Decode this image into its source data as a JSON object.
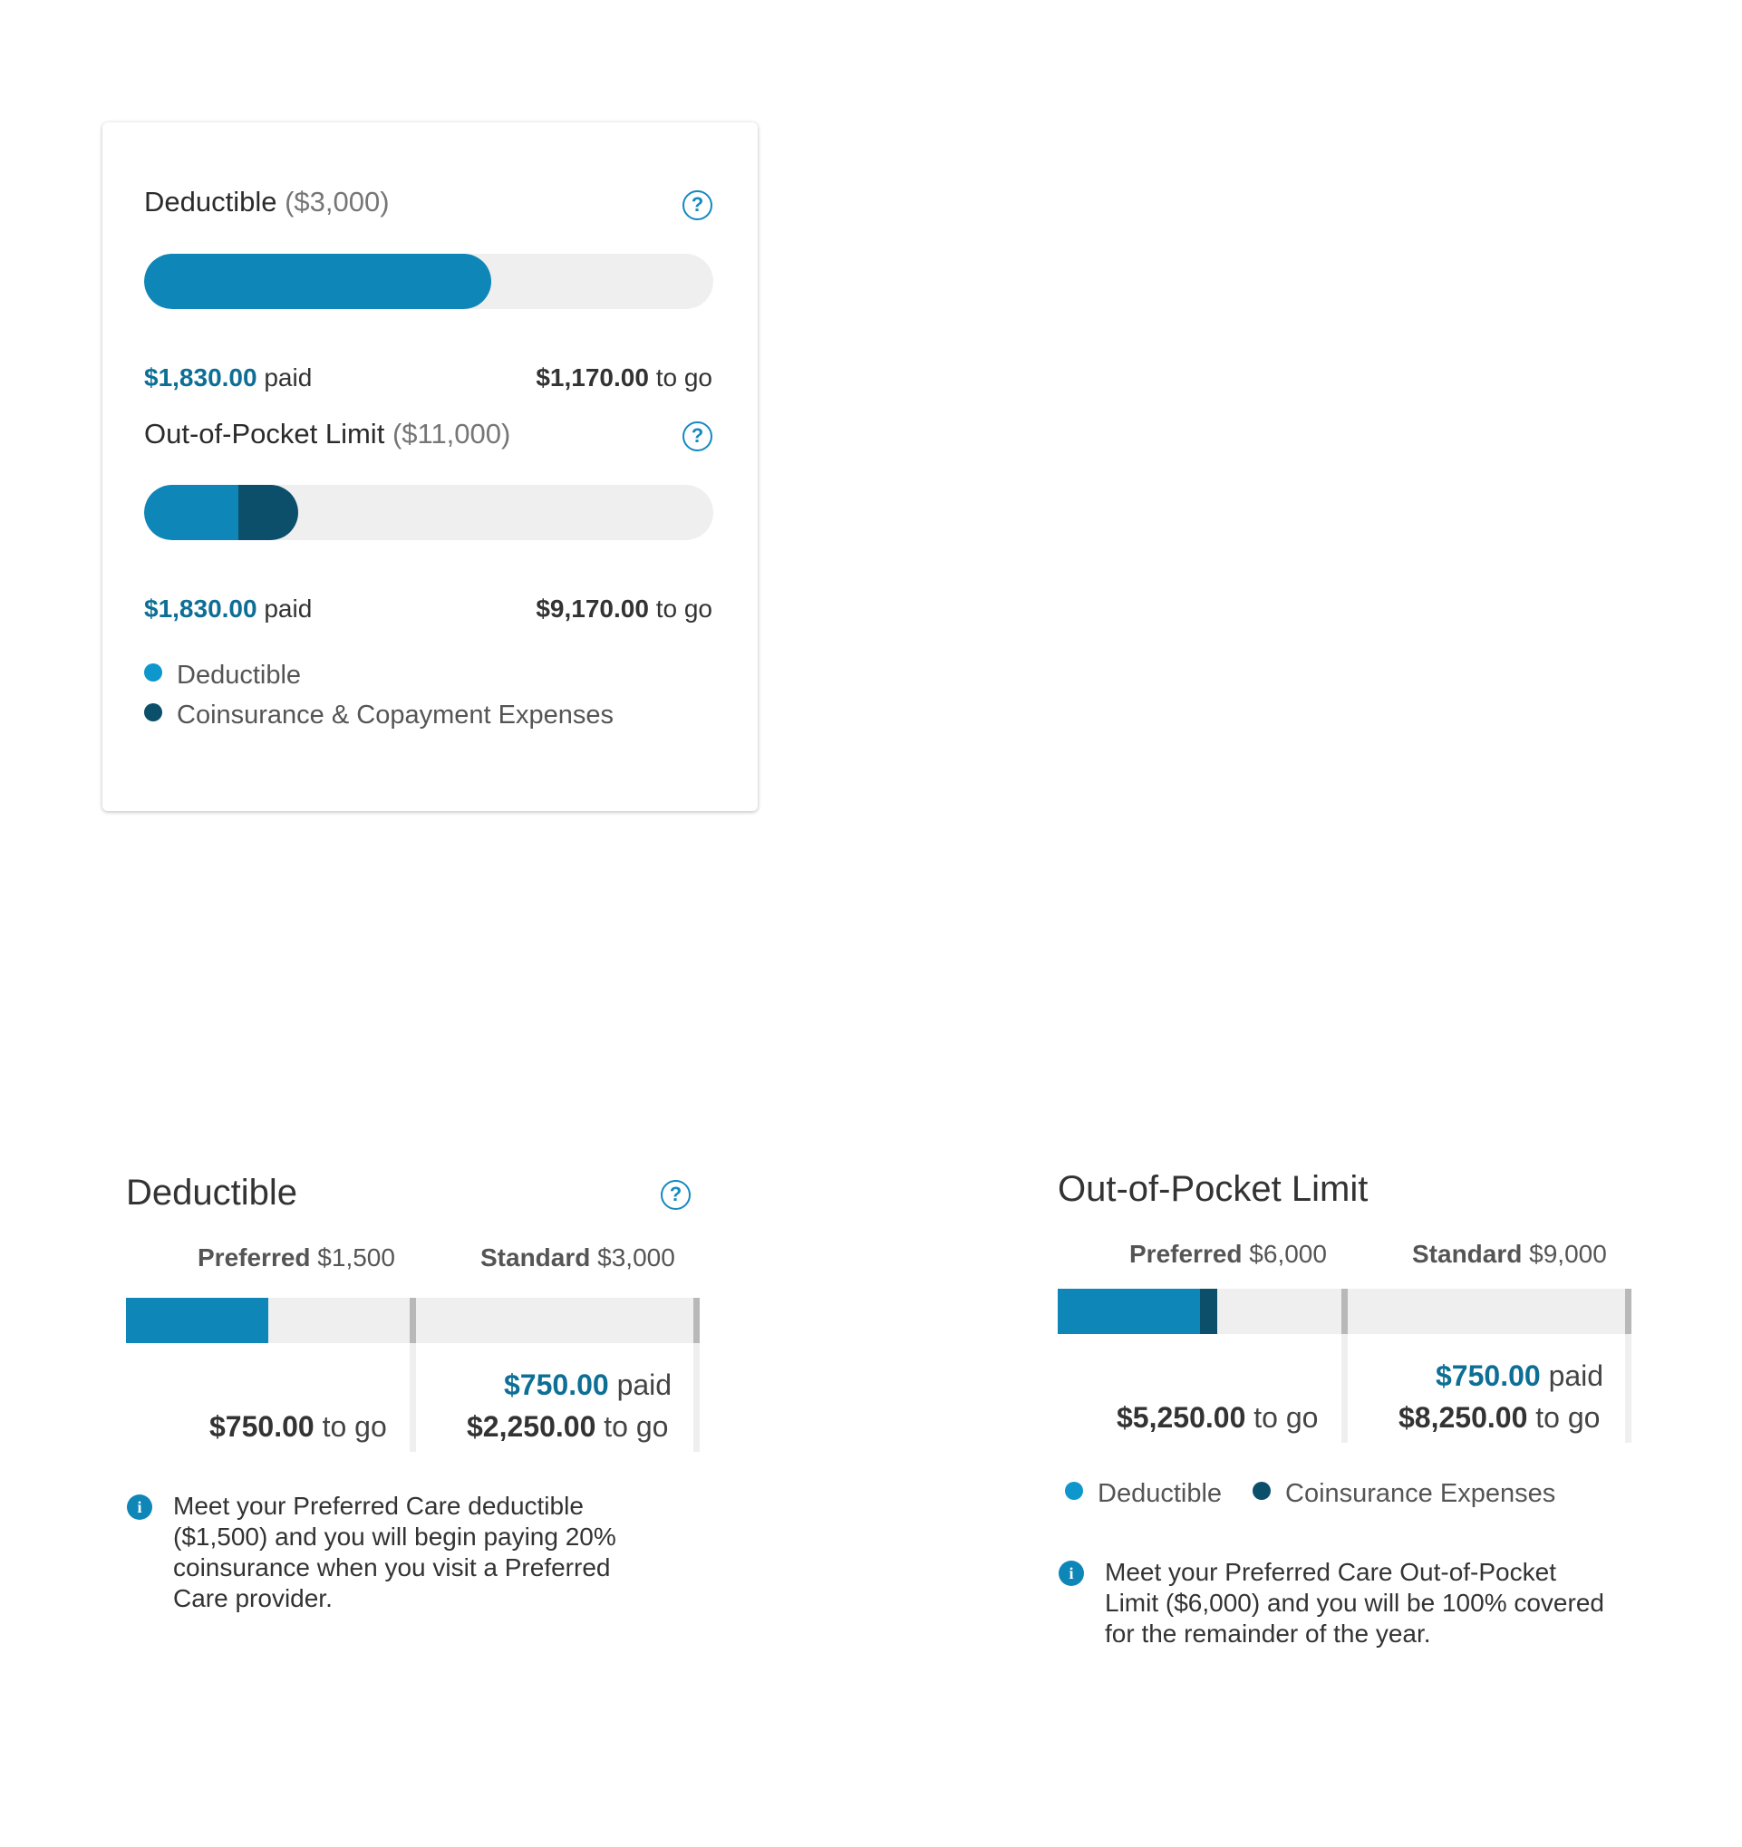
{
  "card": {
    "deductible": {
      "title": "Deductible",
      "amount": "($3,000)",
      "paid_value": "$1,830.00",
      "paid_suffix": "paid",
      "togo_value": "$1,170.00",
      "togo_suffix": "to go",
      "progress_fraction": 0.61
    },
    "oop": {
      "title": "Out-of-Pocket Limit",
      "amount": "($11,000)",
      "paid_value": "$1,830.00",
      "paid_suffix": "paid",
      "togo_value": "$9,170.00",
      "togo_suffix": "to go",
      "deductible_fraction": 0.166,
      "coinsurance_fraction": 0.104
    },
    "legend": {
      "deductible": "Deductible",
      "coinsurance": "Coinsurance & Copayment Expenses"
    },
    "help_glyph": "?"
  },
  "deductible_panel": {
    "title": "Deductible",
    "help_glyph": "?",
    "preferred_label": "Preferred",
    "preferred_amount": "$1,500",
    "standard_label": "Standard",
    "standard_amount": "$3,000",
    "preferred_togo_value": "$750.00",
    "preferred_togo_suffix": "to go",
    "standard_paid_value": "$750.00",
    "standard_paid_suffix": "paid",
    "standard_togo_value": "$2,250.00",
    "standard_togo_suffix": "to go",
    "info_glyph": "i",
    "info_text": "Meet your Preferred Care deductible ($1,500) and you will begin paying 20% coinsurance when you visit a Preferred Care provider.",
    "preferred_fill_fraction": 0.5
  },
  "oop_panel": {
    "title": "Out-of-Pocket Limit",
    "preferred_label": "Preferred",
    "preferred_amount": "$6,000",
    "standard_label": "Standard",
    "standard_amount": "$9,000",
    "preferred_togo_value": "$5,250.00",
    "preferred_togo_suffix": "to go",
    "standard_paid_value": "$750.00",
    "standard_paid_suffix": "paid",
    "standard_togo_value": "$8,250.00",
    "standard_togo_suffix": "to go",
    "legend_deductible": "Deductible",
    "legend_coinsurance": "Coinsurance Expenses",
    "info_glyph": "i",
    "info_text": "Meet your Preferred Care Out-of-Pocket Limit ($6,000) and you will be 100% covered for the remainder of the year.",
    "deductible_fill_fraction": 0.5,
    "coinsurance_fill_fraction": 0.0625
  },
  "colors": {
    "primary": "#0e87b8",
    "dark": "#0b4f6b",
    "paid_text": "#0e6f96",
    "track": "#efefef"
  }
}
